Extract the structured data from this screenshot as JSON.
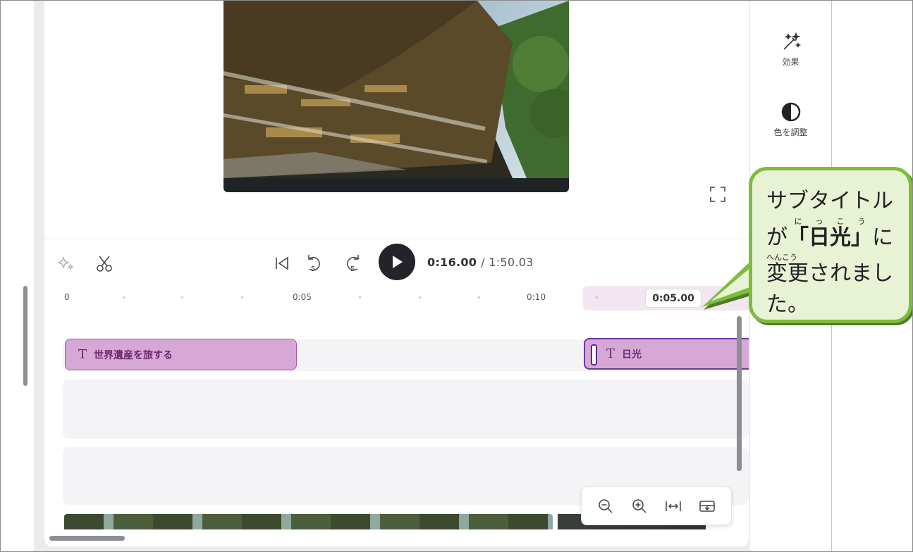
{
  "sidebar": {
    "effects_label": "効果",
    "color_label": "色を調整"
  },
  "player": {
    "current_time": "0:16.00",
    "total_time": "/ 1:50.03"
  },
  "timeline": {
    "ruler_labels": [
      "0",
      "0:05",
      "0:10"
    ],
    "playhead_time": "0:05.00",
    "clips": [
      {
        "label": "世界遺産を旅する",
        "selected": false
      },
      {
        "label": "日光",
        "selected": true
      }
    ],
    "clip_color": "#d7a8d5",
    "clip_border_color": "#a25aa3"
  },
  "callout": {
    "line1": "サブタイトル",
    "line2_prefix": "が",
    "line2_emph": "「日光」",
    "line2_suffix": "に",
    "ruby_nikkou": "にっこう",
    "ruby_henkou": "へんこう",
    "line3": "変更されまし",
    "line4": "た。",
    "border_color": "#7cbd3c",
    "bg_color": "#e8f3d6"
  }
}
